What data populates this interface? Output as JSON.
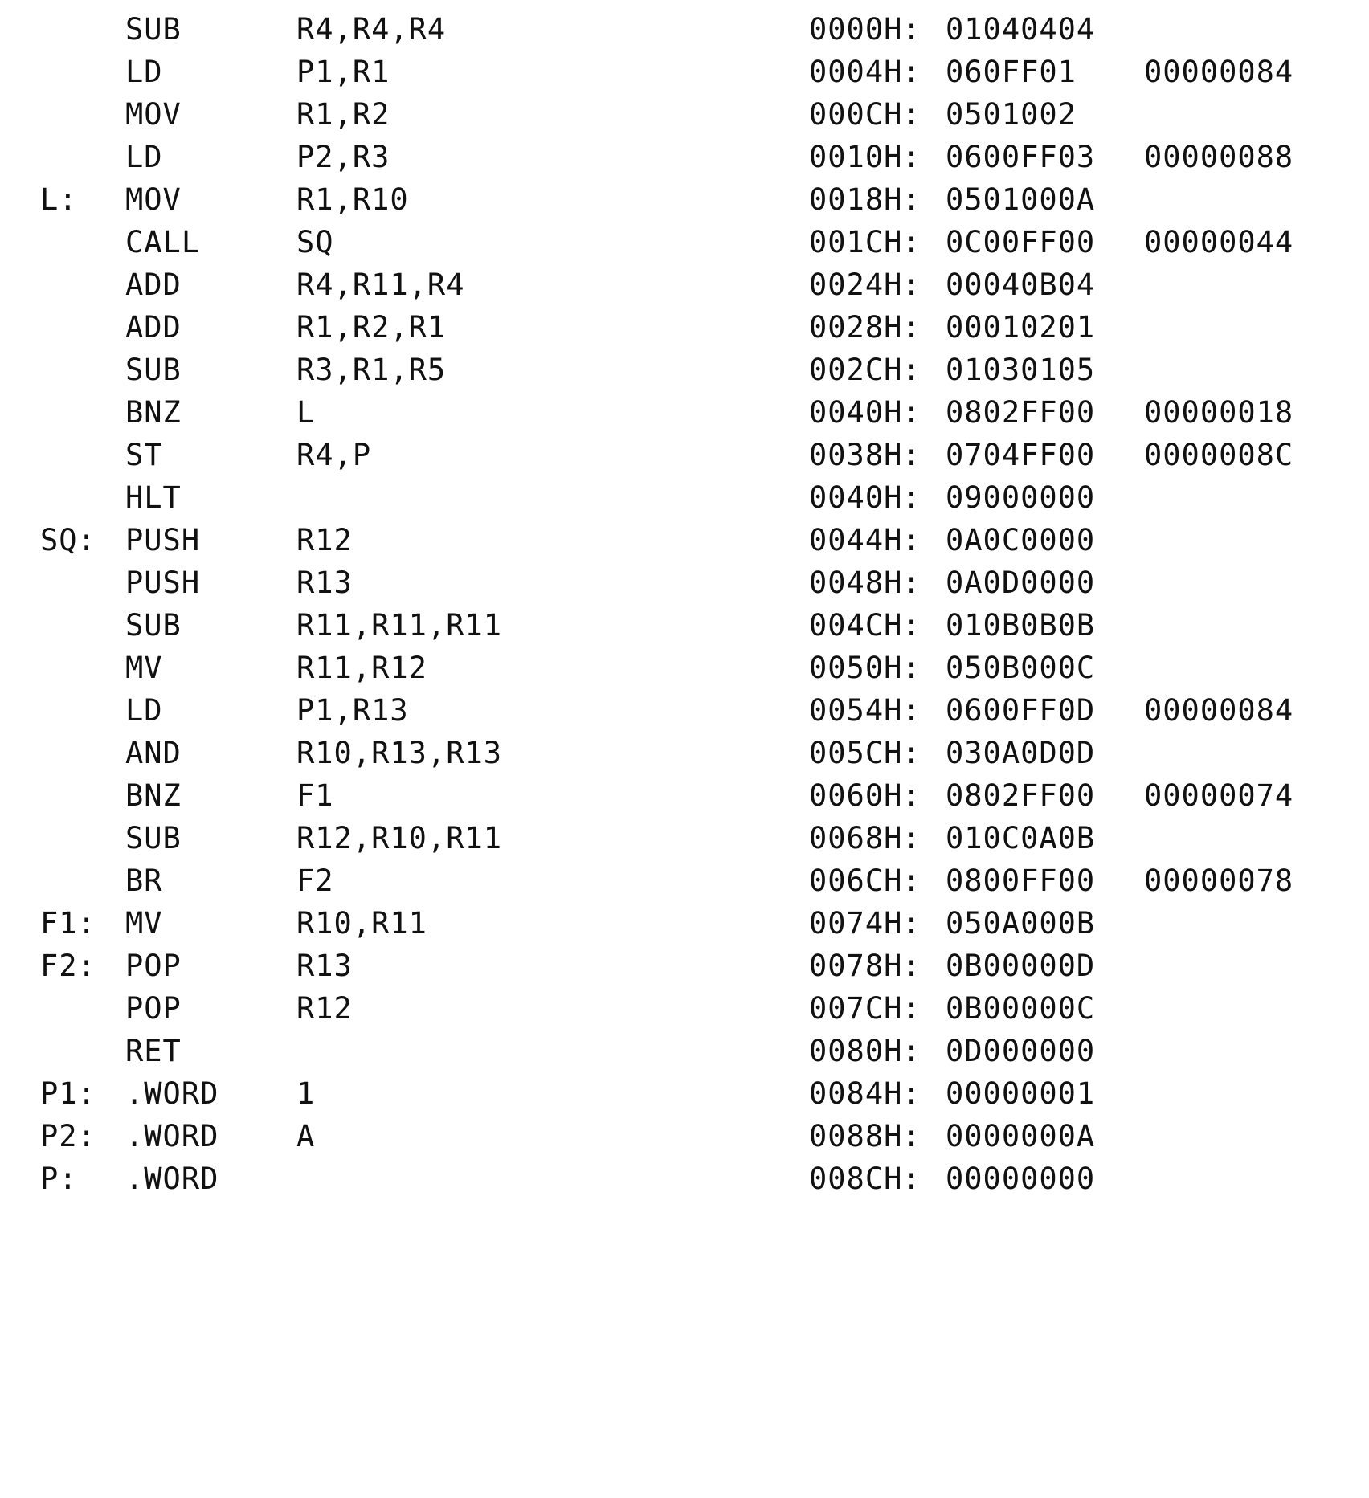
{
  "rows": [
    {
      "label": "",
      "op": "SUB",
      "operands": "R4,R4,R4",
      "addr": "0000H:",
      "code": "01040404",
      "extra": ""
    },
    {
      "label": "",
      "op": "LD",
      "operands": "P1,R1",
      "addr": "0004H:",
      "code": "060FF01",
      "extra": "00000084"
    },
    {
      "label": "",
      "op": "MOV",
      "operands": "R1,R2",
      "addr": "000CH:",
      "code": "0501002",
      "extra": ""
    },
    {
      "label": "",
      "op": "LD",
      "operands": "P2,R3",
      "addr": "0010H:",
      "code": "0600FF03",
      "extra": "00000088"
    },
    {
      "label": "L:",
      "op": "MOV",
      "operands": "R1,R10",
      "addr": "0018H:",
      "code": "0501000A",
      "extra": ""
    },
    {
      "label": "",
      "op": "CALL",
      "operands": "SQ",
      "addr": "001CH:",
      "code": "0C00FF00",
      "extra": "00000044"
    },
    {
      "label": "",
      "op": "ADD",
      "operands": "R4,R11,R4",
      "addr": "0024H:",
      "code": "00040B04",
      "extra": ""
    },
    {
      "label": "",
      "op": "ADD",
      "operands": "R1,R2,R1",
      "addr": "0028H:",
      "code": "00010201",
      "extra": ""
    },
    {
      "label": "",
      "op": "SUB",
      "operands": "R3,R1,R5",
      "addr": "002CH:",
      "code": "01030105",
      "extra": ""
    },
    {
      "label": "",
      "op": "BNZ",
      "operands": "L",
      "addr": "0040H:",
      "code": "0802FF00",
      "extra": "00000018"
    },
    {
      "label": "",
      "op": "ST",
      "operands": "R4,P",
      "addr": "0038H:",
      "code": "0704FF00",
      "extra": "0000008C"
    },
    {
      "label": "",
      "op": "HLT",
      "operands": "",
      "addr": "0040H:",
      "code": "09000000",
      "extra": ""
    },
    {
      "label": "SQ:",
      "op": "PUSH",
      "operands": "R12",
      "addr": "0044H:",
      "code": "0A0C0000",
      "extra": ""
    },
    {
      "label": "",
      "op": "PUSH",
      "operands": "R13",
      "addr": "0048H:",
      "code": "0A0D0000",
      "extra": ""
    },
    {
      "label": "",
      "op": "SUB",
      "operands": "R11,R11,R11",
      "addr": "004CH:",
      "code": "010B0B0B",
      "extra": ""
    },
    {
      "label": "",
      "op": "MV",
      "operands": "R11,R12",
      "addr": "0050H:",
      "code": "050B000C",
      "extra": ""
    },
    {
      "label": "",
      "op": "LD",
      "operands": "P1,R13",
      "addr": "0054H:",
      "code": "0600FF0D",
      "extra": "00000084"
    },
    {
      "label": "",
      "op": "AND",
      "operands": "R10,R13,R13",
      "addr": "005CH:",
      "code": "030A0D0D",
      "extra": ""
    },
    {
      "label": "",
      "op": "BNZ",
      "operands": "F1",
      "addr": "0060H:",
      "code": "0802FF00",
      "extra": "00000074"
    },
    {
      "label": "",
      "op": "SUB",
      "operands": "R12,R10,R11",
      "addr": "0068H:",
      "code": "010C0A0B",
      "extra": ""
    },
    {
      "label": "",
      "op": "BR",
      "operands": "F2",
      "addr": "006CH:",
      "code": "0800FF00",
      "extra": "00000078"
    },
    {
      "label": "F1:",
      "op": "MV",
      "operands": "R10,R11",
      "addr": "0074H:",
      "code": "050A000B",
      "extra": ""
    },
    {
      "label": "F2:",
      "op": "POP",
      "operands": "R13",
      "addr": "0078H:",
      "code": "0B00000D",
      "extra": ""
    },
    {
      "label": "",
      "op": "POP",
      "operands": "R12",
      "addr": "007CH:",
      "code": "0B00000C",
      "extra": ""
    },
    {
      "label": "",
      "op": "RET",
      "operands": "",
      "addr": "0080H:",
      "code": "0D000000",
      "extra": ""
    },
    {
      "label": "P1:",
      "op": ".WORD",
      "operands": "1",
      "addr": "0084H:",
      "code": "00000001",
      "extra": ""
    },
    {
      "label": "P2:",
      "op": ".WORD",
      "operands": "A",
      "addr": "0088H:",
      "code": "0000000A",
      "extra": ""
    },
    {
      "label": "P:",
      "op": ".WORD",
      "operands": "",
      "addr": "008CH:",
      "code": "00000000",
      "extra": ""
    }
  ]
}
